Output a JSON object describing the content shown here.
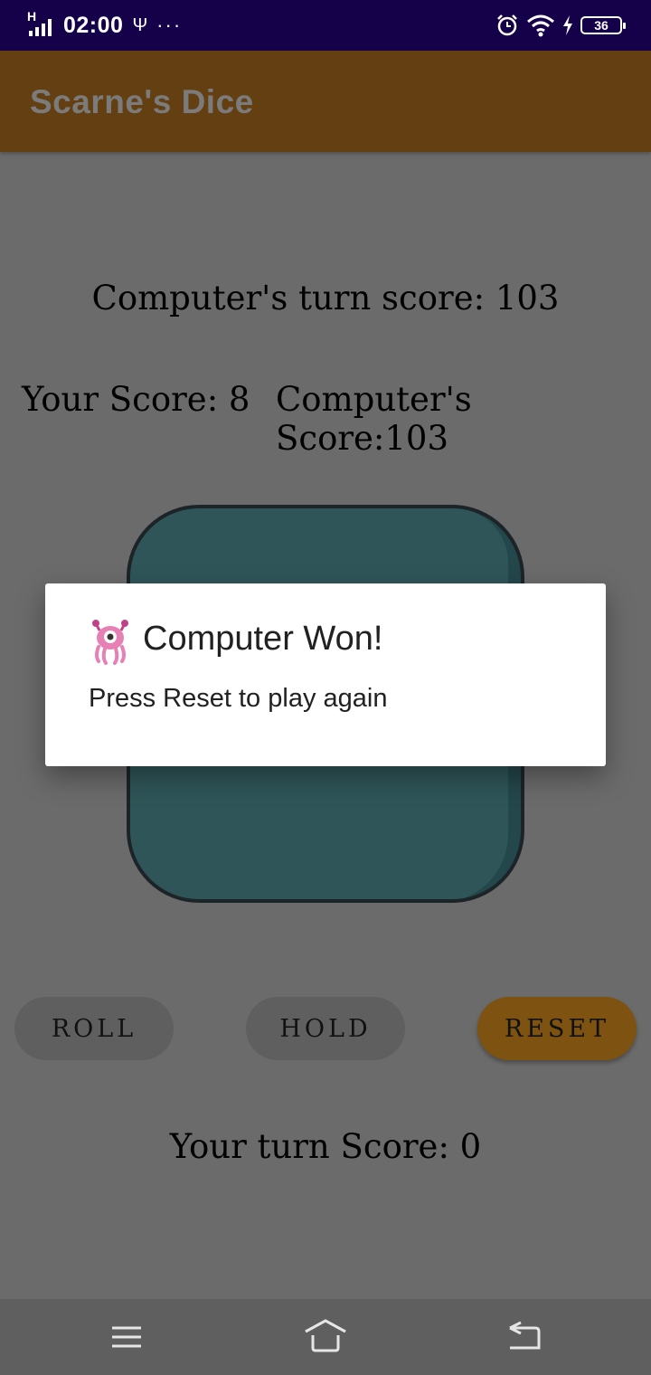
{
  "status": {
    "time": "02:00",
    "signal_label": "H",
    "usb": "Ψ",
    "more": "···",
    "battery": "36"
  },
  "app": {
    "title": "Scarne's Dice"
  },
  "scores": {
    "computer_turn": "Computer's turn score: 103",
    "yours": "Your Score: 8",
    "computer": "Computer's Score:103",
    "your_turn": "Your turn Score: 0"
  },
  "buttons": {
    "roll": "ROLL",
    "hold": "HOLD",
    "reset": "RESET"
  },
  "dialog": {
    "title": "Computer Won!",
    "message": "Press Reset to play again",
    "icon": "alien-monster-icon"
  },
  "colors": {
    "status_bar": "#15004a",
    "app_bar": "#633f12",
    "die": "#2f5558",
    "reset_button": "#7e5311",
    "scrim": "#6b6b6b"
  },
  "nav": {
    "icons": [
      "menu-icon",
      "home-icon",
      "back-icon"
    ]
  }
}
